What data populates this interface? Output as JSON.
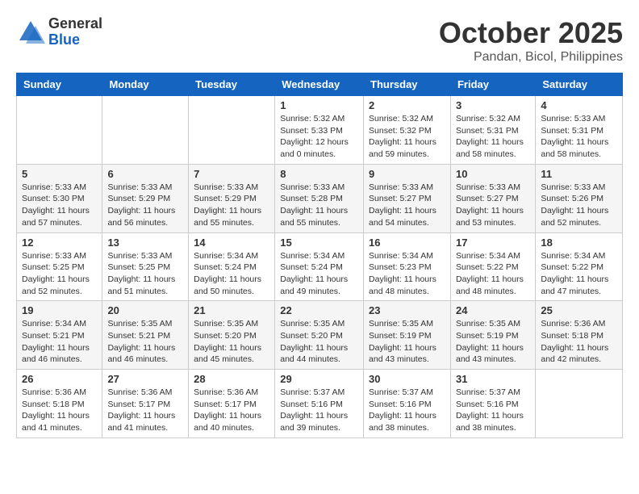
{
  "logo": {
    "general": "General",
    "blue": "Blue"
  },
  "title": "October 2025",
  "subtitle": "Pandan, Bicol, Philippines",
  "days_of_week": [
    "Sunday",
    "Monday",
    "Tuesday",
    "Wednesday",
    "Thursday",
    "Friday",
    "Saturday"
  ],
  "weeks": [
    [
      {
        "day": "",
        "info": ""
      },
      {
        "day": "",
        "info": ""
      },
      {
        "day": "",
        "info": ""
      },
      {
        "day": "1",
        "info": "Sunrise: 5:32 AM\nSunset: 5:33 PM\nDaylight: 12 hours and 0 minutes."
      },
      {
        "day": "2",
        "info": "Sunrise: 5:32 AM\nSunset: 5:32 PM\nDaylight: 11 hours and 59 minutes."
      },
      {
        "day": "3",
        "info": "Sunrise: 5:32 AM\nSunset: 5:31 PM\nDaylight: 11 hours and 58 minutes."
      },
      {
        "day": "4",
        "info": "Sunrise: 5:33 AM\nSunset: 5:31 PM\nDaylight: 11 hours and 58 minutes."
      }
    ],
    [
      {
        "day": "5",
        "info": "Sunrise: 5:33 AM\nSunset: 5:30 PM\nDaylight: 11 hours and 57 minutes."
      },
      {
        "day": "6",
        "info": "Sunrise: 5:33 AM\nSunset: 5:29 PM\nDaylight: 11 hours and 56 minutes."
      },
      {
        "day": "7",
        "info": "Sunrise: 5:33 AM\nSunset: 5:29 PM\nDaylight: 11 hours and 55 minutes."
      },
      {
        "day": "8",
        "info": "Sunrise: 5:33 AM\nSunset: 5:28 PM\nDaylight: 11 hours and 55 minutes."
      },
      {
        "day": "9",
        "info": "Sunrise: 5:33 AM\nSunset: 5:27 PM\nDaylight: 11 hours and 54 minutes."
      },
      {
        "day": "10",
        "info": "Sunrise: 5:33 AM\nSunset: 5:27 PM\nDaylight: 11 hours and 53 minutes."
      },
      {
        "day": "11",
        "info": "Sunrise: 5:33 AM\nSunset: 5:26 PM\nDaylight: 11 hours and 52 minutes."
      }
    ],
    [
      {
        "day": "12",
        "info": "Sunrise: 5:33 AM\nSunset: 5:25 PM\nDaylight: 11 hours and 52 minutes."
      },
      {
        "day": "13",
        "info": "Sunrise: 5:33 AM\nSunset: 5:25 PM\nDaylight: 11 hours and 51 minutes."
      },
      {
        "day": "14",
        "info": "Sunrise: 5:34 AM\nSunset: 5:24 PM\nDaylight: 11 hours and 50 minutes."
      },
      {
        "day": "15",
        "info": "Sunrise: 5:34 AM\nSunset: 5:24 PM\nDaylight: 11 hours and 49 minutes."
      },
      {
        "day": "16",
        "info": "Sunrise: 5:34 AM\nSunset: 5:23 PM\nDaylight: 11 hours and 48 minutes."
      },
      {
        "day": "17",
        "info": "Sunrise: 5:34 AM\nSunset: 5:22 PM\nDaylight: 11 hours and 48 minutes."
      },
      {
        "day": "18",
        "info": "Sunrise: 5:34 AM\nSunset: 5:22 PM\nDaylight: 11 hours and 47 minutes."
      }
    ],
    [
      {
        "day": "19",
        "info": "Sunrise: 5:34 AM\nSunset: 5:21 PM\nDaylight: 11 hours and 46 minutes."
      },
      {
        "day": "20",
        "info": "Sunrise: 5:35 AM\nSunset: 5:21 PM\nDaylight: 11 hours and 46 minutes."
      },
      {
        "day": "21",
        "info": "Sunrise: 5:35 AM\nSunset: 5:20 PM\nDaylight: 11 hours and 45 minutes."
      },
      {
        "day": "22",
        "info": "Sunrise: 5:35 AM\nSunset: 5:20 PM\nDaylight: 11 hours and 44 minutes."
      },
      {
        "day": "23",
        "info": "Sunrise: 5:35 AM\nSunset: 5:19 PM\nDaylight: 11 hours and 43 minutes."
      },
      {
        "day": "24",
        "info": "Sunrise: 5:35 AM\nSunset: 5:19 PM\nDaylight: 11 hours and 43 minutes."
      },
      {
        "day": "25",
        "info": "Sunrise: 5:36 AM\nSunset: 5:18 PM\nDaylight: 11 hours and 42 minutes."
      }
    ],
    [
      {
        "day": "26",
        "info": "Sunrise: 5:36 AM\nSunset: 5:18 PM\nDaylight: 11 hours and 41 minutes."
      },
      {
        "day": "27",
        "info": "Sunrise: 5:36 AM\nSunset: 5:17 PM\nDaylight: 11 hours and 41 minutes."
      },
      {
        "day": "28",
        "info": "Sunrise: 5:36 AM\nSunset: 5:17 PM\nDaylight: 11 hours and 40 minutes."
      },
      {
        "day": "29",
        "info": "Sunrise: 5:37 AM\nSunset: 5:16 PM\nDaylight: 11 hours and 39 minutes."
      },
      {
        "day": "30",
        "info": "Sunrise: 5:37 AM\nSunset: 5:16 PM\nDaylight: 11 hours and 38 minutes."
      },
      {
        "day": "31",
        "info": "Sunrise: 5:37 AM\nSunset: 5:16 PM\nDaylight: 11 hours and 38 minutes."
      },
      {
        "day": "",
        "info": ""
      }
    ]
  ]
}
